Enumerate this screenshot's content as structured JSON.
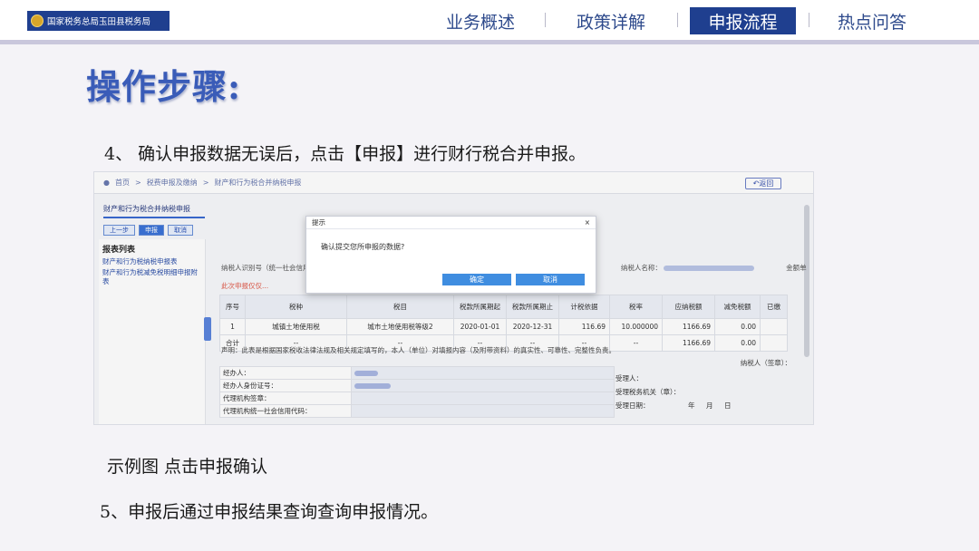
{
  "header": {
    "logo_text": "国家税务总局玉田县税务局",
    "nav": [
      "业务概述",
      "政策详解",
      "申报流程",
      "热点问答"
    ],
    "active_nav_index": 2,
    "accent_color": "#1f3f8f"
  },
  "page_title": "操作步骤:",
  "step4": "4、 确认申报数据无误后，点击【申报】进行财行税合并申报。",
  "screenshot": {
    "breadcrumb": [
      "首页",
      "税费申报及缴纳",
      "财产和行为税合并纳税申报"
    ],
    "back_label": "返回",
    "sub_tab": "财产和行为税合并纳税申报",
    "buttons": [
      "上一步",
      "申报",
      "取消"
    ],
    "sidebar_title": "报表列表",
    "sidebar_items": [
      "财产和行为税纳税申报表",
      "财产和行为税减免税明细申报附表"
    ],
    "taxpayer_id_label": "纳税人识别号（统一社会信用代码）：",
    "taxpayer_name_label": "纳税人名称：",
    "unit_label": "金额单",
    "warning": "此次申报仅仅...",
    "table": {
      "headers": [
        "序号",
        "税种",
        "税目",
        "税款所属期起",
        "税款所属期止",
        "计税依据",
        "税率",
        "应纳税额",
        "减免税额",
        "已缴"
      ],
      "rows": [
        [
          "1",
          "城镇土地使用税",
          "城市土地使用税等级2",
          "2020-01-01",
          "2020-12-31",
          "116.69",
          "10.000000",
          "1166.69",
          "0.00",
          ""
        ],
        [
          "合计",
          "--",
          "--",
          "--",
          "--",
          "--",
          "--",
          "1166.69",
          "0.00",
          ""
        ]
      ]
    },
    "declaration": "声明：此表是根据国家税收法律法规及相关规定填写的，本人（单位）对填报内容（及附带资料）的真实性、可靠性、完整性负责。",
    "taxpayer_sign": "纳税人（签章）：",
    "form_rows": [
      "经办人：",
      "经办人身份证号：",
      "代理机构签章：",
      "代理机构统一社会信用代码："
    ],
    "receipt_rows": [
      "受理人：",
      "受理税务机关（章）：",
      "受理日期：",
      "年",
      "月",
      "日"
    ],
    "dialog": {
      "title": "提示",
      "close": "×",
      "message": "确认提交您所申报的数据?",
      "confirm": "确定",
      "cancel": "取消"
    }
  },
  "caption": "示例图 点击申报确认",
  "step5": "5、申报后通过申报结果查询查询申报情况。"
}
